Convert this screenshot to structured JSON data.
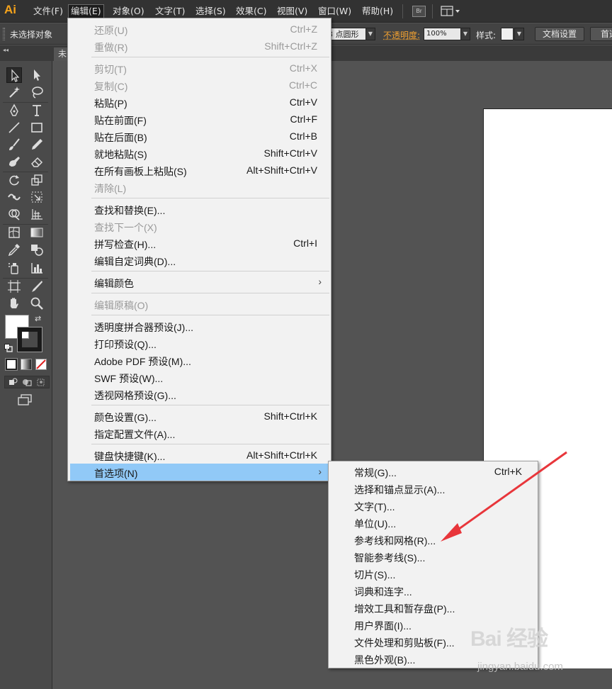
{
  "app": {
    "logo": "Ai"
  },
  "menubar": {
    "items": [
      "文件(F)",
      "编辑(E)",
      "对象(O)",
      "文字(T)",
      "选择(S)",
      "效果(C)",
      "视图(V)",
      "窗口(W)",
      "帮助(H)"
    ],
    "bridge": "Br"
  },
  "controlbar": {
    "selection_status": "未选择对象",
    "shape_field": "3 点圆形",
    "opacity_label": "不透明度:",
    "opacity_value": "100%",
    "style_label": "样式:",
    "doc_setup_button": "文档设置",
    "prefs_button": "首选"
  },
  "document_tab": {
    "label": "未"
  },
  "edit_menu": {
    "items": [
      {
        "label": "还原(U)",
        "shortcut": "Ctrl+Z",
        "disabled": true
      },
      {
        "label": "重做(R)",
        "shortcut": "Shift+Ctrl+Z",
        "disabled": true
      },
      {
        "label": "剪切(T)",
        "shortcut": "Ctrl+X",
        "disabled": true
      },
      {
        "label": "复制(C)",
        "shortcut": "Ctrl+C",
        "disabled": true
      },
      {
        "label": "粘贴(P)",
        "shortcut": "Ctrl+V",
        "disabled": false
      },
      {
        "label": "贴在前面(F)",
        "shortcut": "Ctrl+F",
        "disabled": false
      },
      {
        "label": "贴在后面(B)",
        "shortcut": "Ctrl+B",
        "disabled": false
      },
      {
        "label": "就地粘贴(S)",
        "shortcut": "Shift+Ctrl+V",
        "disabled": false
      },
      {
        "label": "在所有画板上粘贴(S)",
        "shortcut": "Alt+Shift+Ctrl+V",
        "disabled": false
      },
      {
        "label": "清除(L)",
        "shortcut": "",
        "disabled": true
      },
      {
        "label": "查找和替换(E)...",
        "shortcut": "",
        "disabled": false
      },
      {
        "label": "查找下一个(X)",
        "shortcut": "",
        "disabled": true
      },
      {
        "label": "拼写检查(H)...",
        "shortcut": "Ctrl+I",
        "disabled": false
      },
      {
        "label": "编辑自定词典(D)...",
        "shortcut": "",
        "disabled": false
      },
      {
        "label": "编辑颜色",
        "shortcut": "",
        "disabled": false,
        "submenu_arrow": "›"
      },
      {
        "label": "编辑原稿(O)",
        "shortcut": "",
        "disabled": true
      },
      {
        "label": "透明度拼合器预设(J)...",
        "shortcut": "",
        "disabled": false
      },
      {
        "label": "打印预设(Q)...",
        "shortcut": "",
        "disabled": false
      },
      {
        "label": "Adobe PDF 预设(M)...",
        "shortcut": "",
        "disabled": false
      },
      {
        "label": "SWF 预设(W)...",
        "shortcut": "",
        "disabled": false
      },
      {
        "label": "透视网格预设(G)...",
        "shortcut": "",
        "disabled": false
      },
      {
        "label": "颜色设置(G)...",
        "shortcut": "Shift+Ctrl+K",
        "disabled": false
      },
      {
        "label": "指定配置文件(A)...",
        "shortcut": "",
        "disabled": false
      },
      {
        "label": "键盘快捷键(K)...",
        "shortcut": "Alt+Shift+Ctrl+K",
        "disabled": false
      },
      {
        "label": "首选项(N)",
        "shortcut": "",
        "disabled": false,
        "highlighted": true,
        "submenu_arrow": "›"
      }
    ]
  },
  "preferences_submenu": {
    "items": [
      {
        "label": "常规(G)...",
        "shortcut": "Ctrl+K"
      },
      {
        "label": "选择和锚点显示(A)...",
        "shortcut": ""
      },
      {
        "label": "文字(T)...",
        "shortcut": ""
      },
      {
        "label": "单位(U)...",
        "shortcut": ""
      },
      {
        "label": "参考线和网格(R)...",
        "shortcut": ""
      },
      {
        "label": "智能参考线(S)...",
        "shortcut": ""
      },
      {
        "label": "切片(S)...",
        "shortcut": ""
      },
      {
        "label": "词典和连字...",
        "shortcut": ""
      },
      {
        "label": "增效工具和暂存盘(P)...",
        "shortcut": ""
      },
      {
        "label": "用户界面(I)...",
        "shortcut": ""
      },
      {
        "label": "文件处理和剪贴板(F)...",
        "shortcut": ""
      },
      {
        "label": "黑色外观(B)...",
        "shortcut": ""
      }
    ]
  },
  "watermark": {
    "logo": "Bai 经验",
    "url": "jingyan.baidu.com"
  },
  "colors": {
    "highlight": "#91c9f7",
    "annotation_arrow": "#e8363b",
    "opacity_label": "#f0a030",
    "logo": "#f7a41b"
  }
}
